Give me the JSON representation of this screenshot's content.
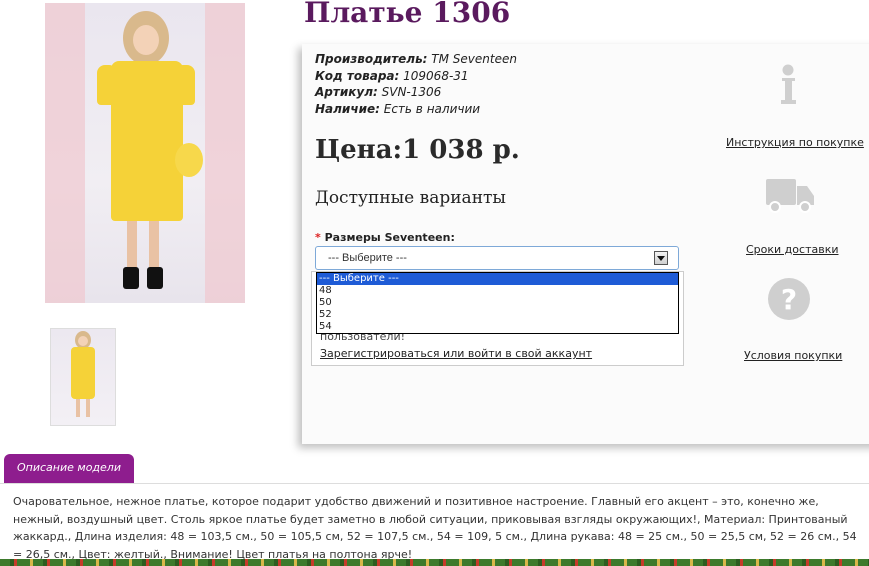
{
  "product": {
    "title": "Платье 1306",
    "info": [
      {
        "label": "Производитель:",
        "value": "ТМ Seventeen"
      },
      {
        "label": "Код товара:",
        "value": "109068-31"
      },
      {
        "label": "Артикул:",
        "value": "SVN-1306"
      },
      {
        "label": "Наличие:",
        "value": "Есть в наличии"
      }
    ],
    "price": "Цена:1 038 р.",
    "variants_heading": "Доступные варианты",
    "size_required_mark": "*",
    "size_label": "Размеры Seventeen:",
    "size_select_value": "--- Выберите ---",
    "size_options": [
      "--- Выберите ---",
      "48",
      "50",
      "52",
      "54"
    ],
    "login_text": "пользователи!",
    "login_link": "Зарегистрироваться или войти в свой аккаунт"
  },
  "sidebar": {
    "instruction": {
      "label": "Инструкция по покупке",
      "icon": "info-icon"
    },
    "delivery": {
      "label": "Сроки доставки",
      "icon": "truck-icon"
    },
    "terms": {
      "label": "Условия покупки",
      "icon": "question-icon"
    }
  },
  "tabs": {
    "description_tab": "Описание модели"
  },
  "description": "Очаровательное, нежное платье, которое подарит удобство движений и позитивное настроение. Главный его акцент – это, конечно же, нежный, воздушный цвет. Столь яркое платье будет заметно в любой ситуации, приковывая взгляды окружающих!, Материал: Принтованый жаккард., Длина изделия: 48 = 103,5 см., 50 = 105,5 см, 52 = 107,5 см., 54 = 109, 5 см., Длина рукава: 48 = 25 см., 50 = 25,5 см, 52 = 26 см., 54 = 26,5 см., Цвет: желтый., Внимание! Цвет платья на полтона ярче!",
  "colors": {
    "title": "#5a1a5e",
    "tab": "#8e1d8e",
    "dress": "#f5d238",
    "selected_option": "#1e5bd6"
  }
}
